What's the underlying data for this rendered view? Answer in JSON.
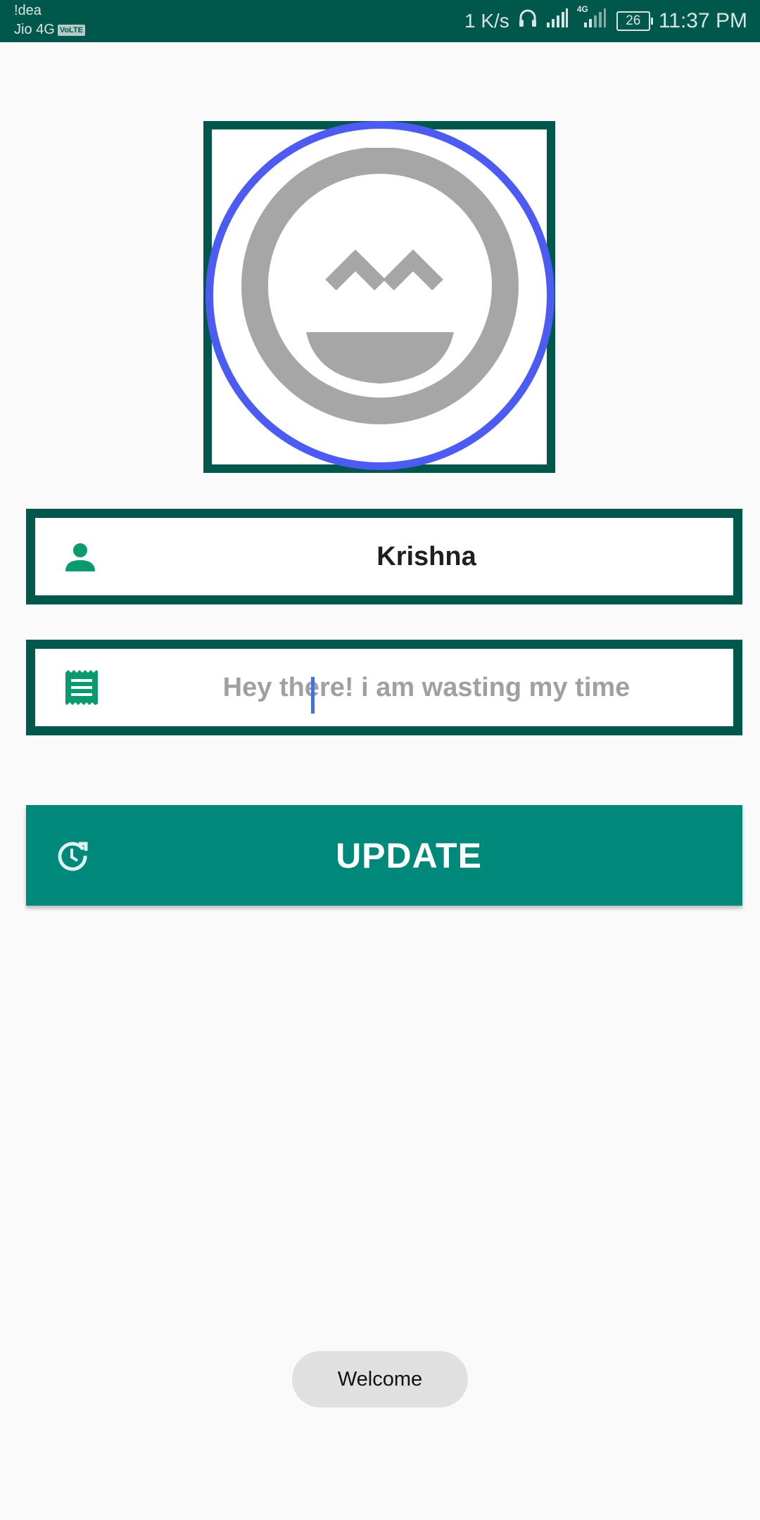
{
  "status_bar": {
    "carrier_1": "!dea",
    "carrier_2": "Jio 4G",
    "volte_badge": "VoLTE",
    "net_speed": "1 K/s",
    "network_type": "4G",
    "battery_level": "26",
    "time": "11:37 PM",
    "icons": [
      "headset-icon",
      "signal-icon",
      "signal-4g-icon",
      "battery-icon"
    ]
  },
  "profile": {
    "avatar_icon": "smiley-face-icon",
    "name_icon": "person-icon",
    "name_value": "Krishna",
    "status_icon": "receipt-icon",
    "status_value": "Hey there! i am wasting my time"
  },
  "actions": {
    "update_label": "UPDATE",
    "update_icon": "update-clock-icon"
  },
  "toast": {
    "message": "Welcome"
  },
  "colors": {
    "status_bar": "#00574b",
    "frame_border": "#00574b",
    "avatar_ring": "#4c5bf1",
    "button": "#00897b",
    "icon_green": "#0a9a6e",
    "caret": "#4a6fd8"
  }
}
